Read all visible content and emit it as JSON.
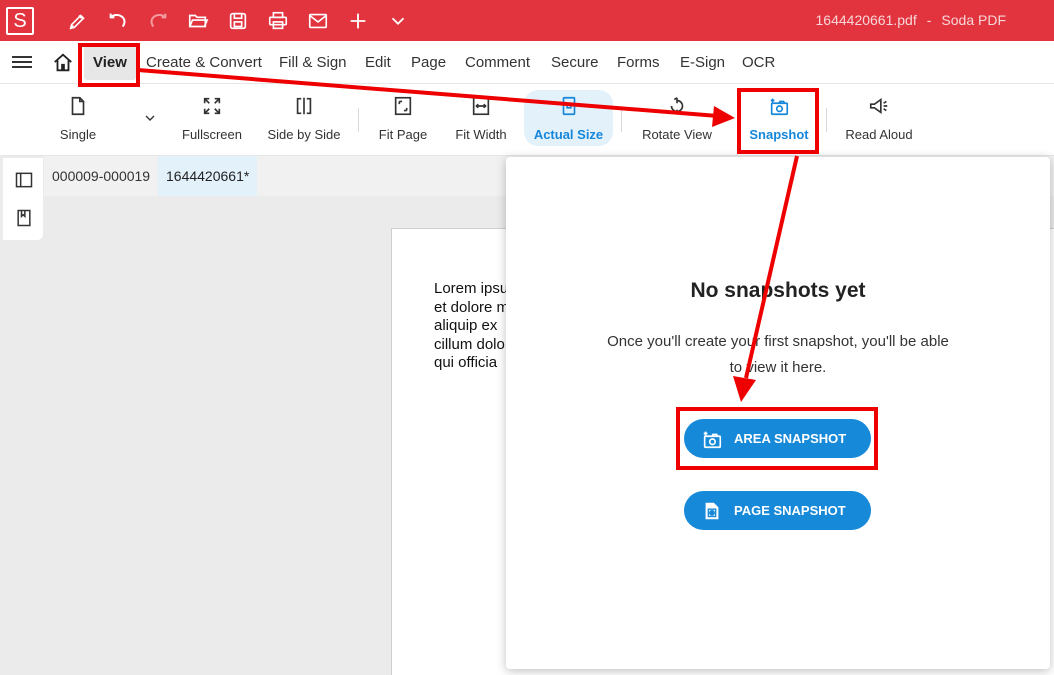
{
  "titlebar": {
    "logo": "S",
    "filename": "1644420661.pdf",
    "separator": "-",
    "app_name": "Soda PDF",
    "icons": [
      "pen-icon",
      "undo-icon",
      "redo-icon",
      "open-folder-icon",
      "save-icon",
      "print-icon",
      "mail-icon",
      "plus-icon",
      "chevron-down-icon"
    ]
  },
  "menubar": {
    "items": [
      "View",
      "Create & Convert",
      "Fill & Sign",
      "Edit",
      "Page",
      "Comment",
      "Secure",
      "Forms",
      "E-Sign",
      "OCR"
    ]
  },
  "toolbar": {
    "single": "Single",
    "fullscreen": "Fullscreen",
    "side_by_side": "Side by Side",
    "fit_page": "Fit Page",
    "fit_width": "Fit Width",
    "actual_size": "Actual Size",
    "rotate_view": "Rotate View",
    "snapshot": "Snapshot",
    "read_aloud": "Read Aloud"
  },
  "tabs": [
    "000009-000019",
    "1644420661*"
  ],
  "document": {
    "lines": [
      "Lorem ipsu",
      "et dolore m",
      "aliquip ex",
      "cillum dolo",
      "qui officia"
    ]
  },
  "snapshot_panel": {
    "title": "No snapshots yet",
    "subtitle": "Once you'll create your first snapshot, you'll be able to view it here.",
    "area_button": "AREA SNAPSHOT",
    "page_button": "PAGE SNAPSHOT"
  },
  "colors": {
    "brand_red": "#e2343f",
    "accent_blue": "#1789d9",
    "annotation_red": "#ee0000"
  }
}
